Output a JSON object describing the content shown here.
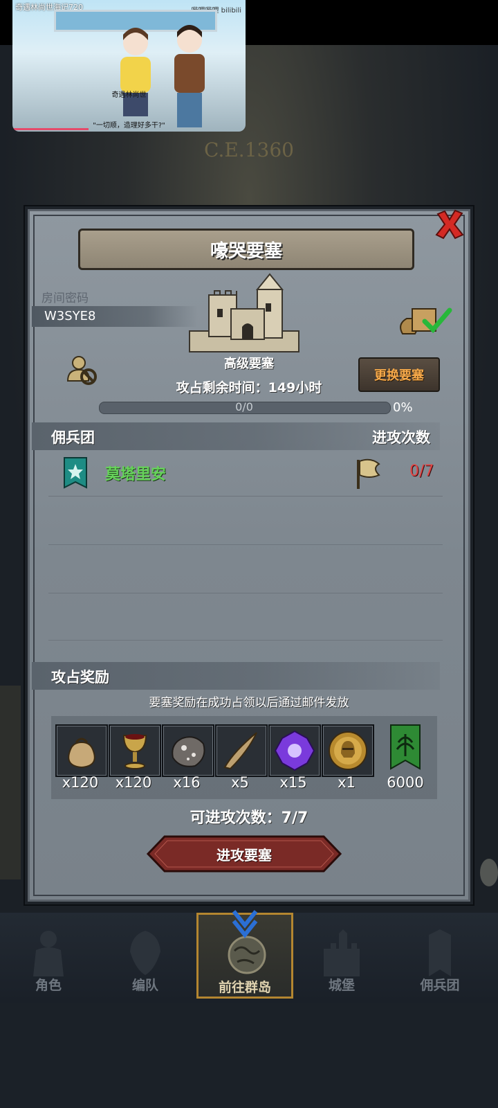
{
  "video": {
    "title": "奇遇林尚世海记720",
    "logo": "哔哩哔哩 bilibili",
    "subtitle_top": "奇遇林尚世",
    "subtitle_bottom": "\"一切顺，造理好多干?\""
  },
  "background": {
    "era_text": "C.E.1360"
  },
  "dialog": {
    "title": "嚎哭要塞",
    "room_label": "房间密码",
    "room_code": "W3SYE8",
    "fortress_name": "高级要塞",
    "change_button": "更换要塞",
    "time_label": "攻占剩余时间：",
    "time_value": "149",
    "time_unit": "小时",
    "progress_text": "0/0",
    "progress_percent": "0%",
    "progress_fraction": 0,
    "mercenary_header": "佣兵团",
    "attacks_header": "进攻次数",
    "guild": {
      "name": "莫塔里安",
      "attacks": "0/7"
    },
    "reward_header": "攻占奖励",
    "reward_note": "要塞奖励在成功占领以后通过邮件发放",
    "rewards": [
      {
        "icon": "bag-icon",
        "qty": "x120"
      },
      {
        "icon": "goblet-icon",
        "qty": "x120"
      },
      {
        "icon": "ore-icon",
        "qty": "x16"
      },
      {
        "icon": "horn-icon",
        "qty": "x5"
      },
      {
        "icon": "purple-gem-icon",
        "qty": "x15"
      },
      {
        "icon": "knight-medal-icon",
        "qty": "x1"
      },
      {
        "icon": "guild-banner-icon",
        "qty": "6000"
      }
    ],
    "available_label": "可进攻次数：",
    "available_value": "7/7",
    "attack_button": "进攻要塞"
  },
  "nav": [
    {
      "icon": "character-icon",
      "label": "角色"
    },
    {
      "icon": "formation-icon",
      "label": "编队"
    },
    {
      "icon": "globe-icon",
      "label": "前往群岛"
    },
    {
      "icon": "castle-icon",
      "label": "城堡"
    },
    {
      "icon": "mercenary-icon",
      "label": "佣兵团"
    }
  ]
}
